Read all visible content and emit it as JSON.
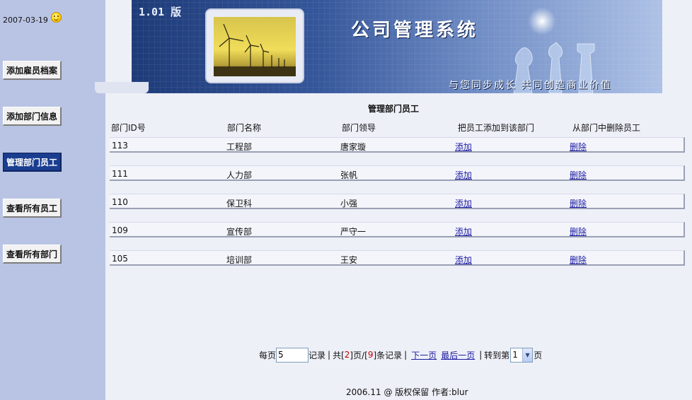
{
  "sidebar": {
    "date": "2007-03-19",
    "items": [
      {
        "label": "添加雇员档案",
        "active": false
      },
      {
        "label": "添加部门信息",
        "active": false
      },
      {
        "label": "管理部门员工",
        "active": true
      },
      {
        "label": "查看所有员工",
        "active": false
      },
      {
        "label": "查看所有部门",
        "active": false
      }
    ]
  },
  "banner": {
    "version": "1.01 版",
    "title": "公司管理系统",
    "slogan": "与您同步成长 共同创造商业价值"
  },
  "main": {
    "title": "管理部门员工",
    "columns": [
      "部门ID号",
      "部门名称",
      "部门领导",
      "把员工添加到该部门",
      "从部门中删除员工"
    ],
    "rows": [
      {
        "id": "113",
        "name": "工程部",
        "leader": "唐家璇",
        "add": "添加",
        "del": "删除"
      },
      {
        "id": "111",
        "name": "人力部",
        "leader": "张帆",
        "add": "添加",
        "del": "删除"
      },
      {
        "id": "110",
        "name": "保卫科",
        "leader": "小强",
        "add": "添加",
        "del": "删除"
      },
      {
        "id": "109",
        "name": "宣传部",
        "leader": "严守一",
        "add": "添加",
        "del": "删除"
      },
      {
        "id": "105",
        "name": "培训部",
        "leader": "王安",
        "add": "添加",
        "del": "删除"
      }
    ]
  },
  "pager": {
    "per_page_label": "每页",
    "per_page_value": "5",
    "records_label": "记录",
    "total_prefix": "共[",
    "total_pages": "2",
    "pages_mid": "]页/[",
    "total_records": "9",
    "records_suffix": "]条记录",
    "next": "下一页",
    "last": "最后一页",
    "goto_label": "转到第",
    "goto_value": "1",
    "page_label": "页",
    "sep": "|"
  },
  "footer": "2006.11 @ 版权保留  作者:blur",
  "colors": {
    "sidebar": "#b9c4e4",
    "background": "#eef0f8",
    "active_nav": "#1a3d8f",
    "link": "#1a1aa0"
  }
}
